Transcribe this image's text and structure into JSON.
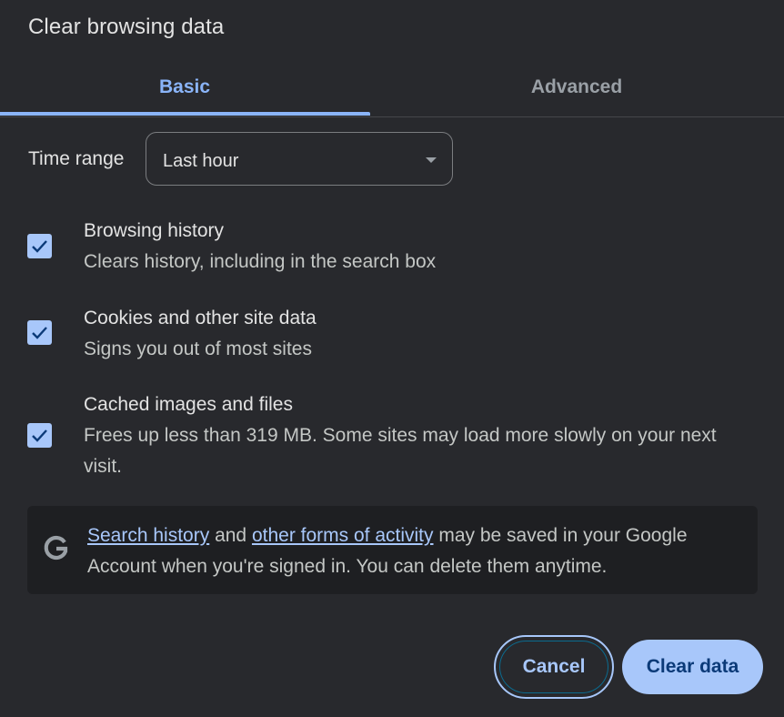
{
  "dialog": {
    "title": "Clear browsing data"
  },
  "tabs": [
    {
      "label": "Basic",
      "selected": true
    },
    {
      "label": "Advanced",
      "selected": false
    }
  ],
  "time_range": {
    "label": "Time range",
    "value": "Last hour"
  },
  "options": [
    {
      "title": "Browsing history",
      "description": "Clears history, including in the search box",
      "checked": true
    },
    {
      "title": "Cookies and other site data",
      "description": "Signs you out of most sites",
      "checked": true
    },
    {
      "title": "Cached images and files",
      "description": "Frees up less than 319 MB. Some sites may load more slowly on your next visit.",
      "checked": true
    }
  ],
  "info": {
    "icon": "google-g-icon",
    "link1": "Search history",
    "and": " and ",
    "link2": "other forms of activity",
    "rest": " may be saved in your Google Account when you're signed in. You can delete them anytime."
  },
  "buttons": {
    "cancel": "Cancel",
    "clear": "Clear data"
  },
  "colors": {
    "accent": "#8ab4f8",
    "button_fill": "#a8c7fa",
    "background": "#28292d"
  }
}
